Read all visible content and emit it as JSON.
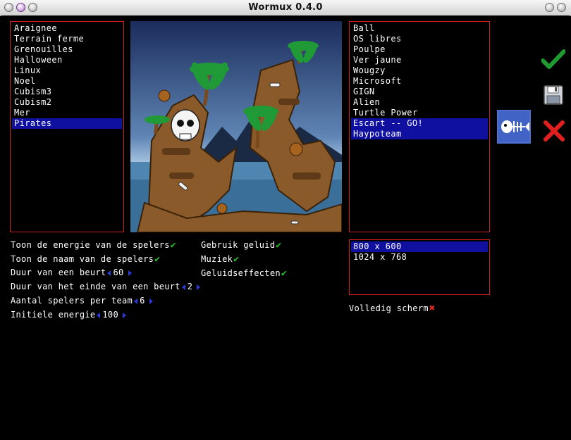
{
  "window": {
    "title": "Wormux 0.4.0"
  },
  "maps": {
    "items": [
      "Araignee",
      "Terrain ferme",
      "Grenouilles",
      "Halloween",
      "Linux",
      "Noel",
      "Cubism3",
      "Cubism2",
      "Mer",
      "Pirates"
    ],
    "selected": "Pirates"
  },
  "teams": {
    "items": [
      "Ball",
      "OS libres",
      "Poulpe",
      "Ver jaune",
      "Wougzy",
      "Microsoft",
      "GIGN",
      "Alien",
      "Turtle Power",
      "Escart -- GO!",
      "Haypoteam"
    ],
    "selected": [
      "Escart -- GO!",
      "Haypoteam"
    ]
  },
  "resolutions": {
    "items": [
      "800 x 600",
      "1024 x 768"
    ],
    "selected": "800 x 600"
  },
  "options": {
    "show_energy": "Toon de energie van de spelers",
    "show_name": "Toon de naam van de spelers",
    "turn_duration": "Duur van een beurt",
    "turn_duration_value": "60",
    "end_turn_duration": "Duur van het einde van een beurt",
    "end_turn_duration_value": "2",
    "players_per_team": "Aantal spelers per team",
    "players_per_team_value": "6",
    "initial_energy": "Initiele energie",
    "initial_energy_value": "100"
  },
  "sound": {
    "use_sound": "Gebruik geluid",
    "music": "Muziek",
    "effects": "Geluidseffecten"
  },
  "fullscreen_label": "Volledig scherm",
  "icons": {
    "ok": "checkmark-icon",
    "save": "floppy-disk-icon",
    "cancel": "cross-icon",
    "team_logo": "fish-skeleton-icon",
    "check": "checkmark-icon",
    "off": "cross-icon"
  },
  "colors": {
    "list_border": "#d02020",
    "selection": "#1010a0",
    "check": "#22c02a",
    "cross": "#e52a2a",
    "arrow": "#2b3bd8"
  }
}
